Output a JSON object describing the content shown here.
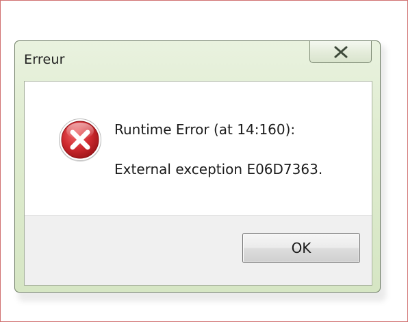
{
  "window": {
    "title": "Erreur"
  },
  "message": {
    "line1": "Runtime Error (at 14:160):",
    "line2": "External exception E06D7363."
  },
  "buttons": {
    "ok_label": "OK"
  },
  "icons": {
    "error": "error-x-icon",
    "close": "close-icon"
  },
  "colors": {
    "error_red": "#c8232b",
    "title_bar": "#dfeccf"
  }
}
